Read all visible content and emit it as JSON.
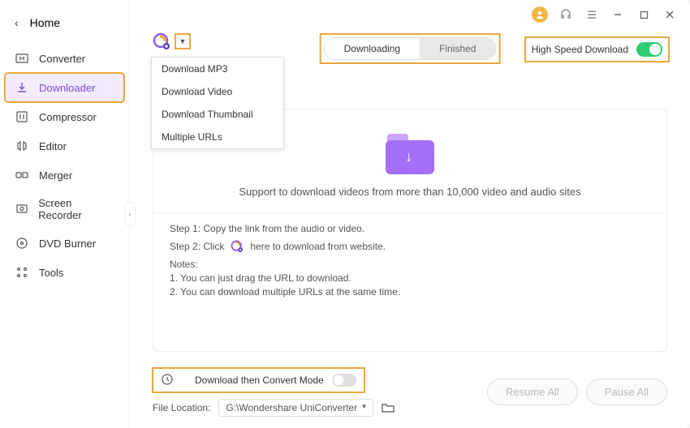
{
  "sidebar": {
    "home_label": "Home",
    "items": [
      {
        "label": "Converter",
        "icon": "converter-icon"
      },
      {
        "label": "Downloader",
        "icon": "downloader-icon"
      },
      {
        "label": "Compressor",
        "icon": "compressor-icon"
      },
      {
        "label": "Editor",
        "icon": "editor-icon"
      },
      {
        "label": "Merger",
        "icon": "merger-icon"
      },
      {
        "label": "Screen Recorder",
        "icon": "screen-recorder-icon"
      },
      {
        "label": "DVD Burner",
        "icon": "dvd-burner-icon"
      },
      {
        "label": "Tools",
        "icon": "tools-icon"
      }
    ]
  },
  "dropdown": {
    "items": [
      "Download MP3",
      "Download Video",
      "Download Thumbnail",
      "Multiple URLs"
    ]
  },
  "tabs": {
    "downloading": "Downloading",
    "finished": "Finished"
  },
  "hsd_label": "High Speed Download",
  "main": {
    "support_text": "Support to download videos from more than 10,000 video and audio sites",
    "step1": "Step 1: Copy the link from the audio or video.",
    "step2_pre": "Step 2: Click",
    "step2_post": "here to download from website.",
    "notes_label": "Notes:",
    "note1": "1. You can just drag the URL to download.",
    "note2": "2. You can download multiple URLs at the same time."
  },
  "footer": {
    "convert_mode_label": "Download then Convert Mode",
    "file_location_label": "File Location:",
    "file_location_value": "G:\\Wondershare UniConverter",
    "resume_all": "Resume All",
    "pause_all": "Pause All"
  }
}
